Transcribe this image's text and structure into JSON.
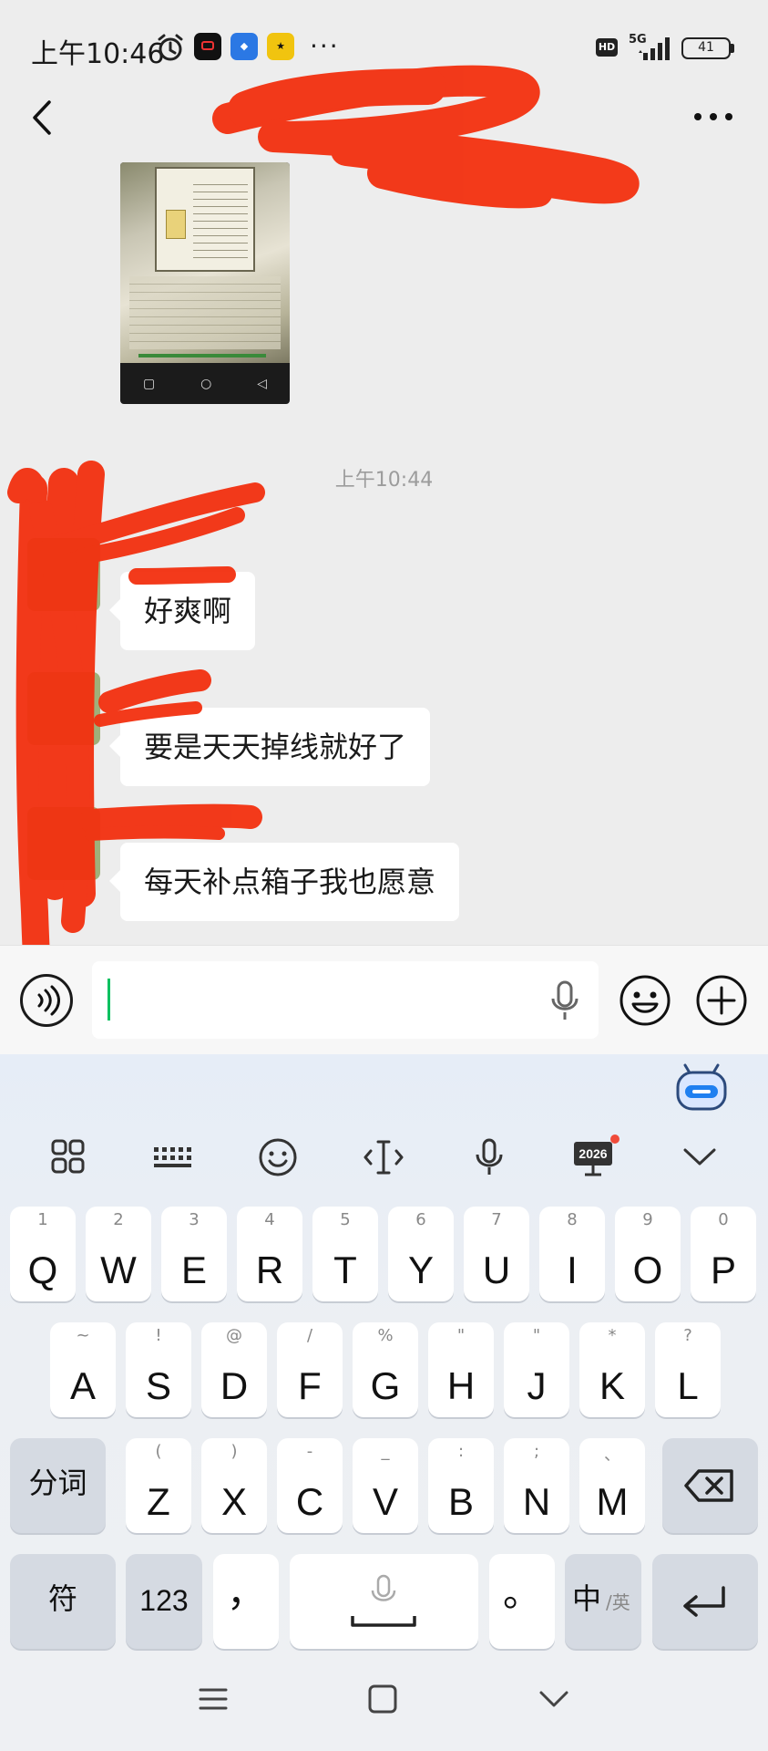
{
  "status_bar": {
    "time": "上午10:46",
    "more": "···",
    "hd": "HD",
    "network": "5G",
    "battery": "41",
    "apps": [
      "app-1",
      "app-2",
      "app-3"
    ]
  },
  "nav": {
    "back_icon": "chevron-left-icon",
    "more_icon": "ellipsis-icon"
  },
  "chat": {
    "timestamp": "上午10:44",
    "messages": [
      {
        "text": "好爽啊"
      },
      {
        "text": "要是天天掉线就好了"
      },
      {
        "text": "每天补点箱子我也愿意"
      }
    ],
    "shared_image": "game-screenshot-thumbnail"
  },
  "input_bar": {
    "voice_icon": "voice-wave-icon",
    "emoji_icon": "smiley-icon",
    "plus_icon": "plus-circle-icon",
    "value": ""
  },
  "keyboard": {
    "toolbar": [
      "apps-grid-icon",
      "keyboard-layout-icon",
      "emoji-icon",
      "cursor-icon",
      "mic-icon",
      "2026-icon",
      "chevron-down-icon"
    ],
    "toolbar_2026": "2026",
    "row1": [
      {
        "main": "Q",
        "sub": "1"
      },
      {
        "main": "W",
        "sub": "2"
      },
      {
        "main": "E",
        "sub": "3"
      },
      {
        "main": "R",
        "sub": "4"
      },
      {
        "main": "T",
        "sub": "5"
      },
      {
        "main": "Y",
        "sub": "6"
      },
      {
        "main": "U",
        "sub": "7"
      },
      {
        "main": "I",
        "sub": "8"
      },
      {
        "main": "O",
        "sub": "9"
      },
      {
        "main": "P",
        "sub": "0"
      }
    ],
    "row2": [
      {
        "main": "A",
        "sub": "~"
      },
      {
        "main": "S",
        "sub": "!"
      },
      {
        "main": "D",
        "sub": "@"
      },
      {
        "main": "F",
        "sub": "/"
      },
      {
        "main": "G",
        "sub": "%"
      },
      {
        "main": "H",
        "sub": "\""
      },
      {
        "main": "J",
        "sub": "\""
      },
      {
        "main": "K",
        "sub": "*"
      },
      {
        "main": "L",
        "sub": "?"
      }
    ],
    "row3": [
      {
        "main": "Z",
        "sub": "("
      },
      {
        "main": "X",
        "sub": ")"
      },
      {
        "main": "C",
        "sub": "-"
      },
      {
        "main": "V",
        "sub": "_"
      },
      {
        "main": "B",
        "sub": ":"
      },
      {
        "main": "N",
        "sub": ";"
      },
      {
        "main": "M",
        "sub": "、"
      }
    ],
    "fenci": "分词",
    "symbols": "符",
    "numbers": "123",
    "comma": "，",
    "period": "。",
    "lang_main": "中",
    "lang_sub": "/英",
    "backspace_icon": "backspace-icon",
    "enter_icon": "enter-icon",
    "space_icon": "space-mic-icon"
  },
  "system_nav": [
    "menu-icon",
    "home-icon",
    "back-chevron-icon"
  ],
  "colors": {
    "chat_bg": "#ededed",
    "bubble": "#ffffff",
    "caret": "#07c160",
    "scribble": "#f3300f"
  }
}
